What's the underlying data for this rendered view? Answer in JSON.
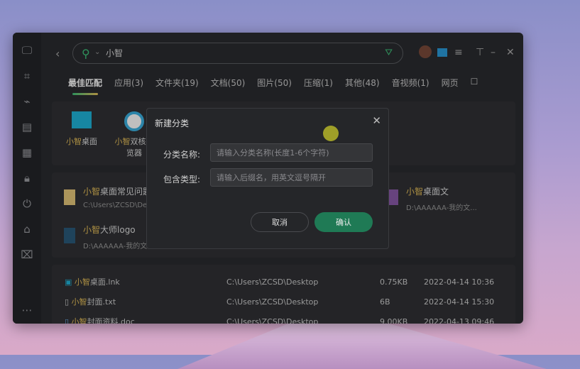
{
  "search": {
    "query": "小智"
  },
  "tabs": [
    "最佳匹配",
    "应用(3)",
    "文件夹(19)",
    "文档(50)",
    "图片(50)",
    "压缩(1)",
    "其他(48)",
    "音视频(1)",
    "网页"
  ],
  "apps": [
    {
      "hl": "小智",
      "rest": "桌面"
    },
    {
      "hl": "小智",
      "rest": "双核浏览器"
    }
  ],
  "folders": [
    {
      "hl": "小智",
      "rest": "桌面常见问题",
      "path": "C:\\Users\\ZCSD\\Desktop"
    },
    {
      "hl": "小智",
      "rest": "桌面文",
      "path": "D:\\AAAAAA-我的文..."
    },
    {
      "hl": "小智",
      "rest": "大师logo",
      "path": "D:\\AAAAAA-我的文"
    }
  ],
  "files": [
    {
      "hl": "小智",
      "rest": "桌面.lnk",
      "path": "C:\\Users\\ZCSD\\Desktop",
      "size": "0.75KB",
      "date": "2022-04-14 10:36"
    },
    {
      "hl": "小智",
      "rest": "封面.txt",
      "path": "C:\\Users\\ZCSD\\Desktop",
      "size": "6B",
      "date": "2022-04-14 15:30"
    },
    {
      "hl": "小智",
      "rest": "封面资料.doc",
      "path": "C:\\Users\\ZCSD\\Desktop",
      "size": "9.00KB",
      "date": "2022-04-13 09:46"
    }
  ],
  "dialog": {
    "title": "新建分类",
    "name_label": "分类名称:",
    "name_placeholder": "请输入分类名称(长度1-6个字符)",
    "type_label": "包含类型:",
    "type_placeholder": "请输入后缀名，用英文逗号隔开",
    "cancel": "取消",
    "confirm": "确认"
  },
  "colors": {
    "accent": "#3fc27a",
    "highlight": "#e8c15a",
    "confirm": "#1f7a55"
  }
}
